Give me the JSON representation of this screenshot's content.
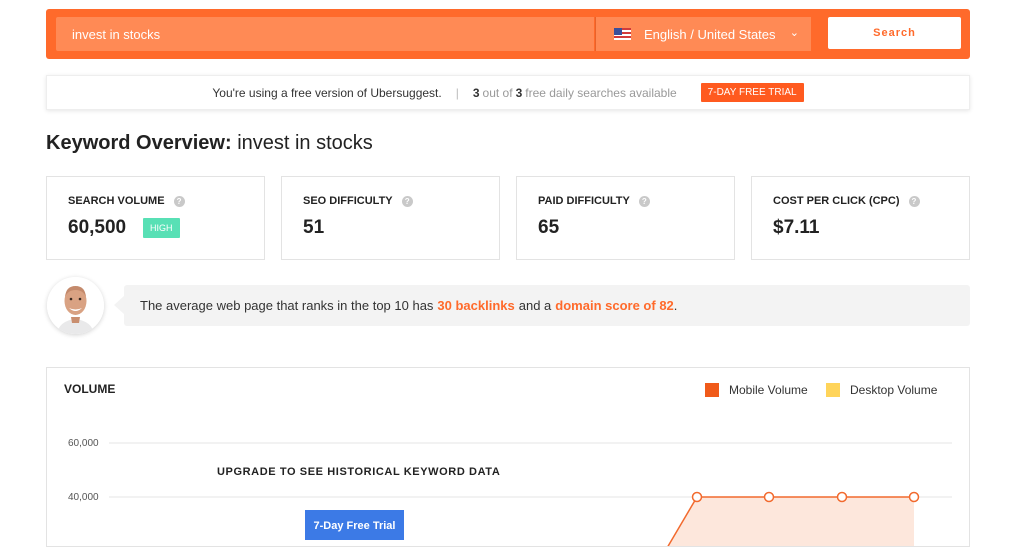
{
  "search": {
    "query": "invest in stocks",
    "language": "English / United States",
    "button_label": "Search"
  },
  "notice": {
    "free_text": "You're using a free version of Ubersuggest.",
    "used": "3",
    "out_of_text": "out of",
    "total": "3",
    "available_text": "free daily searches available",
    "trial_label": "7-DAY FREE TRIAL"
  },
  "heading": {
    "prefix": "Keyword Overview:",
    "keyword": "invest in stocks"
  },
  "stats": [
    {
      "label": "SEARCH VOLUME",
      "value": "60,500",
      "badge": "HIGH"
    },
    {
      "label": "SEO DIFFICULTY",
      "value": "51"
    },
    {
      "label": "PAID DIFFICULTY",
      "value": "65"
    },
    {
      "label": "COST PER CLICK (CPC)",
      "value": "$7.11"
    }
  ],
  "tip": {
    "part1": "The average web page that ranks in the top 10 has",
    "backlinks": "30 backlinks",
    "part2": "and a",
    "domain_score": "domain score of 82",
    "part3": "."
  },
  "volume": {
    "title": "VOLUME",
    "legend": [
      {
        "label": "Mobile Volume",
        "color": "#f05a1a"
      },
      {
        "label": "Desktop Volume",
        "color": "#ffd45a"
      }
    ],
    "upgrade_text": "UPGRADE TO SEE HISTORICAL KEYWORD DATA",
    "trial_button": "7-Day Free Trial"
  },
  "chart_data": {
    "type": "area",
    "y_ticks": [
      "60,000",
      "40,000"
    ],
    "ylim": [
      0,
      60000
    ],
    "series": [
      {
        "name": "Mobile Volume",
        "values": [
          40000,
          40000,
          40000,
          40000
        ]
      }
    ]
  },
  "colors": {
    "brand": "#ff6a2b",
    "high_badge": "#58e0b5",
    "trial_blue": "#3c7ae6"
  }
}
